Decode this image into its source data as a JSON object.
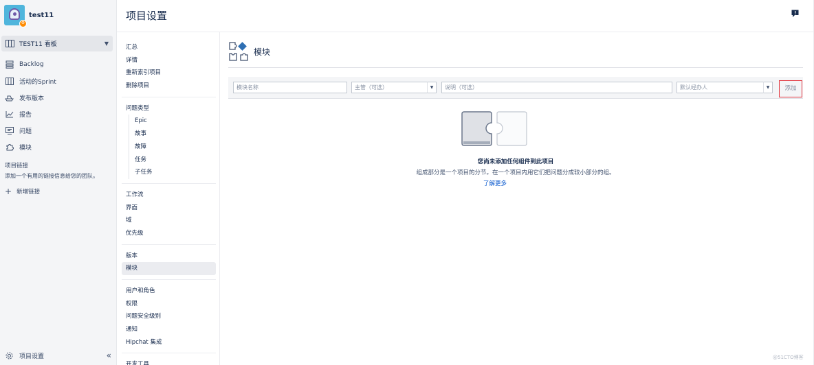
{
  "project": {
    "name": "test11",
    "avatar_badge": "⚙"
  },
  "board_selector": {
    "label": "TEST11 看板",
    "icon": "board-icon"
  },
  "nav": [
    {
      "label": "Backlog",
      "icon": "backlog-icon"
    },
    {
      "label": "活动的Sprint",
      "icon": "active-sprint-icon"
    },
    {
      "label": "发布版本",
      "icon": "ship-icon"
    },
    {
      "label": "报告",
      "icon": "report-chart-icon"
    },
    {
      "label": "问题",
      "icon": "issues-icon"
    },
    {
      "label": "模块",
      "icon": "puzzle-icon"
    }
  ],
  "project_links": {
    "title": "项目链接",
    "description": "添加一个有用的链接信息给您的团队。",
    "add_label": "新增链接"
  },
  "footer": {
    "label": "项目设置",
    "collapse": "«"
  },
  "header": {
    "title": "项目设置"
  },
  "settings_menu": {
    "group1": [
      "汇总",
      "详情",
      "重新索引项目",
      "删除项目"
    ],
    "issue_types_title": "问题类型",
    "issue_types": [
      "Epic",
      "故事",
      "故障",
      "任务",
      "子任务"
    ],
    "group3": [
      "工作流",
      "界面",
      "域",
      "优先级"
    ],
    "group4": [
      "版本",
      "模块"
    ],
    "group5": [
      "用户和角色",
      "权限",
      "问题安全级别",
      "通知",
      "Hipchat 集成"
    ],
    "group6": [
      "开发工具"
    ]
  },
  "main": {
    "section_title": "模块",
    "form": {
      "name_placeholder": "模块名称",
      "lead_placeholder": "主管（可选）",
      "desc_placeholder": "说明（可选）",
      "assignee_placeholder": "默认经办人",
      "add_label": "添加"
    },
    "empty": {
      "title": "您尚未添加任何组件到此项目",
      "description": "组成部分是一个项目的分节。在一个项目内用它们把问题分成较小部分的组。",
      "learn_more": "了解更多"
    }
  },
  "watermark": "@51CTO博客"
}
